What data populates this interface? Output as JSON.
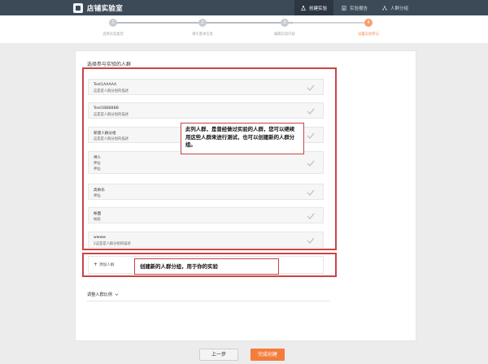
{
  "brand": {
    "title": "店铺实验室"
  },
  "nav": [
    {
      "label": "创建实验",
      "icon": "flask-icon"
    },
    {
      "label": "实验报告",
      "icon": "report-icon"
    },
    {
      "label": "人群分组",
      "icon": "group-icon"
    }
  ],
  "steps": [
    {
      "number": "1",
      "label": "选择实验类型"
    },
    {
      "number": "2",
      "label": "填写基本信息"
    },
    {
      "number": "3",
      "label": "编辑实验内容"
    },
    {
      "number": "4",
      "label": "设置实验参与"
    }
  ],
  "section": {
    "title": "选择参与实验的人群"
  },
  "audiences": [
    {
      "name": "Test1AAAAA",
      "desc": "这是是人群分组的描述"
    },
    {
      "name": "Test1BBBBBB",
      "desc": "这是是人群分组的描述"
    },
    {
      "name": "新建人群分组",
      "desc": "这是是人群分组的描述"
    },
    {
      "name": "神人",
      "desc": "神仙",
      "desc2": "神仙"
    },
    {
      "name": "高帅乐",
      "desc": "神仙"
    },
    {
      "name": "帐面",
      "desc": "帐面"
    },
    {
      "name": "wwww",
      "desc": "2这是是人群分组的描述"
    }
  ],
  "annotations": {
    "top": "此列人群，是曾经做过实验的人群，您可以继续用这些人群来进行测试，也可以创建新的人群分组。",
    "bottom": "创建新的人群分组，用于你的实验"
  },
  "add_group": {
    "label": "添加人群"
  },
  "ratio": {
    "label": "调整人群比例"
  },
  "buttons": {
    "prev": "上一步",
    "done": "完成创建"
  },
  "colors": {
    "topbar": "#3c4a58",
    "accent": "#f47c3c",
    "annotation_border": "#c94444"
  }
}
